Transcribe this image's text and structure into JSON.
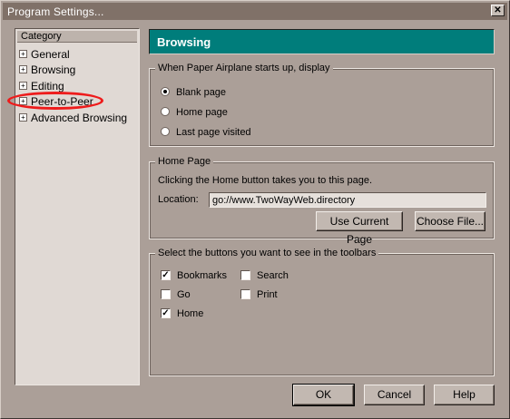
{
  "window": {
    "title": "Program Settings..."
  },
  "category": {
    "header": "Category",
    "items": [
      {
        "label": "General"
      },
      {
        "label": "Browsing"
      },
      {
        "label": "Editing"
      },
      {
        "label": "Peer-to-Peer"
      },
      {
        "label": "Advanced Browsing"
      }
    ]
  },
  "panel": {
    "title": "Browsing"
  },
  "startup": {
    "legend": "When Paper Airplane starts up, display",
    "options": [
      {
        "label": "Blank page",
        "selected": true
      },
      {
        "label": "Home page",
        "selected": false
      },
      {
        "label": "Last page visited",
        "selected": false
      }
    ]
  },
  "homepage": {
    "legend": "Home Page",
    "description": "Clicking the Home button takes you to this page.",
    "location_label": "Location:",
    "location_value": "go://www.TwoWayWeb.directory",
    "use_current_label": "Use Current Page",
    "choose_file_label": "Choose File..."
  },
  "toolbars": {
    "legend": "Select the buttons you want to see in the toolbars",
    "items": [
      {
        "label": "Bookmarks",
        "checked": true
      },
      {
        "label": "Search",
        "checked": false
      },
      {
        "label": "Go",
        "checked": false
      },
      {
        "label": "Print",
        "checked": false
      },
      {
        "label": "Home",
        "checked": true
      }
    ]
  },
  "footer": {
    "ok_label": "OK",
    "cancel_label": "Cancel",
    "help_label": "Help"
  },
  "colors": {
    "accent": "#007d7b",
    "highlight_ring": "#ee1b1b",
    "dialog_bg": "#ab9f98"
  }
}
